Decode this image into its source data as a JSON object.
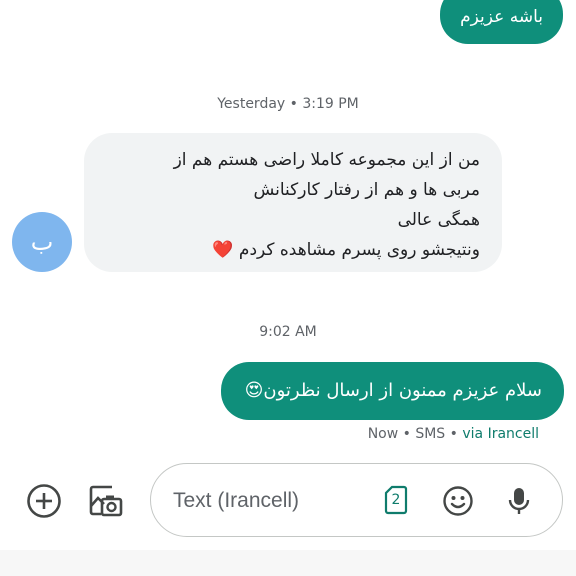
{
  "conversation": {
    "prev_outgoing": "باشه عزیزم",
    "timestamp_yesterday": "Yesterday • 3:19 PM",
    "incoming": {
      "avatar_letter": "ب",
      "lines": [
        "من از این مجموعه کاملا راضی هستم هم از",
        "مربی ها و هم از رفتار کارکنانش",
        "همگی عالی",
        "ونتیجشو روی پسرم مشاهده کردم ❤️"
      ]
    },
    "timestamp_now": "9:02 AM",
    "outgoing": {
      "text": "سلام عزیزم ممنون از ارسال نظرتون😍",
      "status_prefix": "Now • SMS • ",
      "carrier": "via Irancell"
    }
  },
  "composer": {
    "placeholder": "Text (Irancell)",
    "sim_number": "2"
  },
  "colors": {
    "outgoing_bubble": "#0f8f7b",
    "incoming_bubble": "#f1f3f4",
    "avatar": "#7fb6ee",
    "accent": "#0f7c6c"
  },
  "icons": [
    "add-circle-icon",
    "gallery-icon",
    "sim-card-icon",
    "emoji-icon",
    "microphone-icon",
    "heart-emoji",
    "heart-eyes-emoji"
  ]
}
